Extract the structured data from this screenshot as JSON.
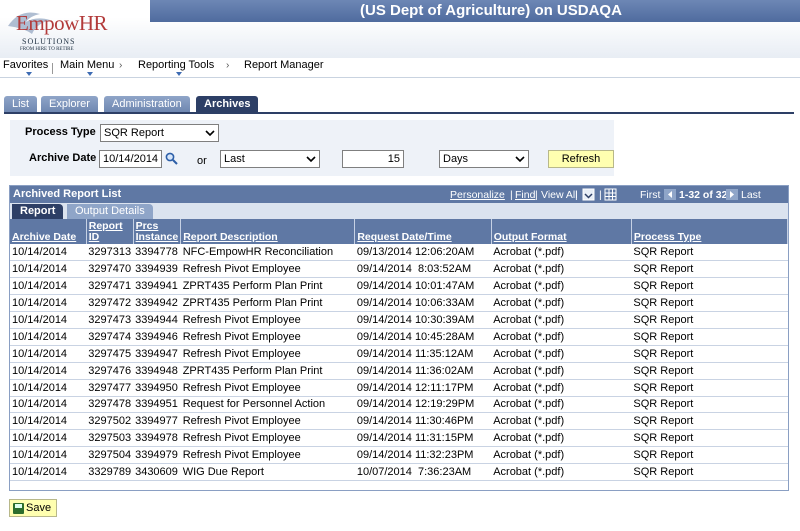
{
  "header": {
    "title": "(US Dept of Agriculture) on USDAQA",
    "logo": {
      "main": "EmpowHR",
      "sub": "SOLUTIONS",
      "tagline": "FROM HIRE TO RETIRE"
    }
  },
  "nav": {
    "favorites": "Favorites",
    "main_menu": "Main Menu",
    "reporting_tools": "Reporting Tools",
    "report_manager": "Report Manager"
  },
  "tabs": [
    "List",
    "Explorer",
    "Administration",
    "Archives"
  ],
  "criteria": {
    "process_type_label": "Process Type",
    "process_type_value": "SQR Report",
    "archive_date_label": "Archive Date",
    "archive_date_value": "10/14/2014",
    "or_label": "or",
    "last_value": "Last",
    "days_count": "15",
    "days_unit": "Days",
    "refresh_label": "Refresh"
  },
  "grid": {
    "title": "Archived Report List",
    "tools": {
      "personalize": "Personalize",
      "find": "Find",
      "view_all": "View All",
      "first": "First",
      "range": "1-32 of 32",
      "last": "Last"
    },
    "tabs": [
      "Report",
      "Output Details"
    ],
    "columns": [
      "Archive Date",
      "Report ID",
      "Prcs Instance",
      "Report Description",
      "Request Date/Time",
      "Output Format",
      "Process Type"
    ],
    "rows": [
      [
        "10/14/2014",
        "3297313",
        "3394778",
        "NFC-EmpowHR Reconciliation",
        "09/13/2014 12:06:20AM",
        "Acrobat (*.pdf)",
        "SQR Report"
      ],
      [
        "10/14/2014",
        "3297470",
        "3394939",
        "Refresh Pivot Employee",
        "09/14/2014  8:03:52AM",
        "Acrobat (*.pdf)",
        "SQR Report"
      ],
      [
        "10/14/2014",
        "3297471",
        "3394941",
        "ZPRT435 Perform Plan Print",
        "09/14/2014 10:01:47AM",
        "Acrobat (*.pdf)",
        "SQR Report"
      ],
      [
        "10/14/2014",
        "3297472",
        "3394942",
        "ZPRT435 Perform Plan Print",
        "09/14/2014 10:06:33AM",
        "Acrobat (*.pdf)",
        "SQR Report"
      ],
      [
        "10/14/2014",
        "3297473",
        "3394944",
        "Refresh Pivot Employee",
        "09/14/2014 10:30:39AM",
        "Acrobat (*.pdf)",
        "SQR Report"
      ],
      [
        "10/14/2014",
        "3297474",
        "3394946",
        "Refresh Pivot Employee",
        "09/14/2014 10:45:28AM",
        "Acrobat (*.pdf)",
        "SQR Report"
      ],
      [
        "10/14/2014",
        "3297475",
        "3394947",
        "Refresh Pivot Employee",
        "09/14/2014 11:35:12AM",
        "Acrobat (*.pdf)",
        "SQR Report"
      ],
      [
        "10/14/2014",
        "3297476",
        "3394948",
        "ZPRT435 Perform Plan Print",
        "09/14/2014 11:36:02AM",
        "Acrobat (*.pdf)",
        "SQR Report"
      ],
      [
        "10/14/2014",
        "3297477",
        "3394950",
        "Refresh Pivot Employee",
        "09/14/2014 12:11:17PM",
        "Acrobat (*.pdf)",
        "SQR Report"
      ],
      [
        "10/14/2014",
        "3297478",
        "3394951",
        "Request for Personnel Action",
        "09/14/2014 12:19:29PM",
        "Acrobat (*.pdf)",
        "SQR Report"
      ],
      [
        "10/14/2014",
        "3297502",
        "3394977",
        "Refresh Pivot Employee",
        "09/14/2014 11:30:46PM",
        "Acrobat (*.pdf)",
        "SQR Report"
      ],
      [
        "10/14/2014",
        "3297503",
        "3394978",
        "Refresh Pivot Employee",
        "09/14/2014 11:31:15PM",
        "Acrobat (*.pdf)",
        "SQR Report"
      ],
      [
        "10/14/2014",
        "3297504",
        "3394979",
        "Refresh Pivot Employee",
        "09/14/2014 11:32:23PM",
        "Acrobat (*.pdf)",
        "SQR Report"
      ],
      [
        "10/14/2014",
        "3329789",
        "3430609",
        "WIG Due Report",
        "10/07/2014  7:36:23AM",
        "Acrobat (*.pdf)",
        "SQR Report"
      ]
    ]
  },
  "save_label": "Save",
  "colors": {
    "band": "#5f78a4",
    "tab_active": "#2d3f66",
    "button_bg": "#ffffb0",
    "brand": "#b23a3a"
  }
}
